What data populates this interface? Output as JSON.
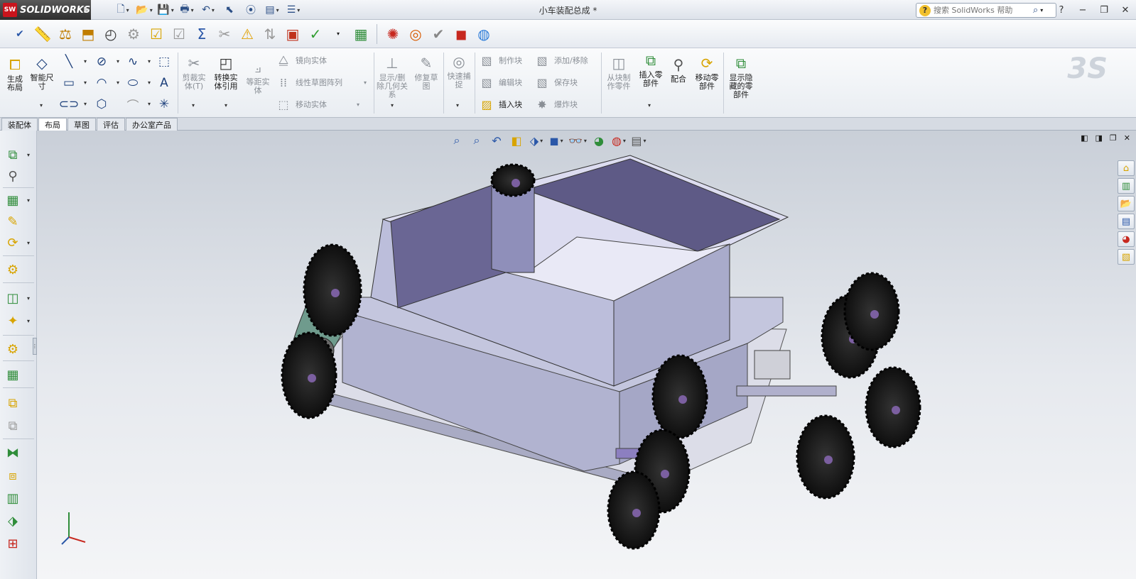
{
  "app": {
    "brand": "SOLIDWORKS",
    "brand_badge": "SW",
    "document_title": "小车装配总成 *",
    "search_placeholder": "搜索 SolidWorks 帮助"
  },
  "window_controls": [
    "?",
    "−",
    "❐",
    "✕"
  ],
  "quickbar": [
    {
      "id": "new",
      "icon": "new-document-icon",
      "glyph": "🗋"
    },
    {
      "id": "open",
      "icon": "open-folder-icon",
      "glyph": "📂"
    },
    {
      "id": "save",
      "icon": "save-icon",
      "glyph": "💾"
    },
    {
      "id": "print",
      "icon": "print-icon",
      "glyph": "🖶"
    },
    {
      "id": "undo",
      "icon": "undo-icon",
      "glyph": "↶"
    },
    {
      "id": "select",
      "icon": "select-pointer-icon",
      "glyph": "⬉"
    },
    {
      "id": "rebuild",
      "icon": "traffic-light-icon",
      "glyph": "⦿"
    },
    {
      "id": "file-props",
      "icon": "file-properties-icon",
      "glyph": "▤"
    },
    {
      "id": "options",
      "icon": "options-icon",
      "glyph": "☰"
    }
  ],
  "tabs": [
    "装配体",
    "布局",
    "草图",
    "评估",
    "办公室产品"
  ],
  "active_tab": "布局",
  "command_manager": {
    "create_layout": "生成布局",
    "smart_dimension": "智能尺寸",
    "trim_entities": "剪裁实体(T)",
    "convert_entities": "转换实体引用",
    "offset_entities": "等距实体",
    "mirror_entities": "镜向实体",
    "linear_pattern": "线性草图阵列",
    "move_entities": "移动实体",
    "show_delete_relations": "显示/删除几何关系",
    "repair_sketch": "修复草图",
    "quick_snaps": "快速捕捉",
    "make_block": "制作块",
    "edit_block": "编辑块",
    "insert_block": "插入块",
    "add_remove": "添加/移除",
    "save_block": "保存块",
    "explode_block": "爆炸块",
    "make_part_from_block": "从块制作零件",
    "insert_components": "插入零部件",
    "mate": "配合",
    "move_component": "移动零部件",
    "show_hidden_components": "显示隐藏的零部件"
  },
  "colors": {
    "body": "#b9bcd9",
    "body_dark": "#5e5a86",
    "body_mid": "#8f8fba",
    "wheel": "#1b1b1b",
    "hub": "#7b5fa0",
    "accent_red": "#c8141c"
  }
}
